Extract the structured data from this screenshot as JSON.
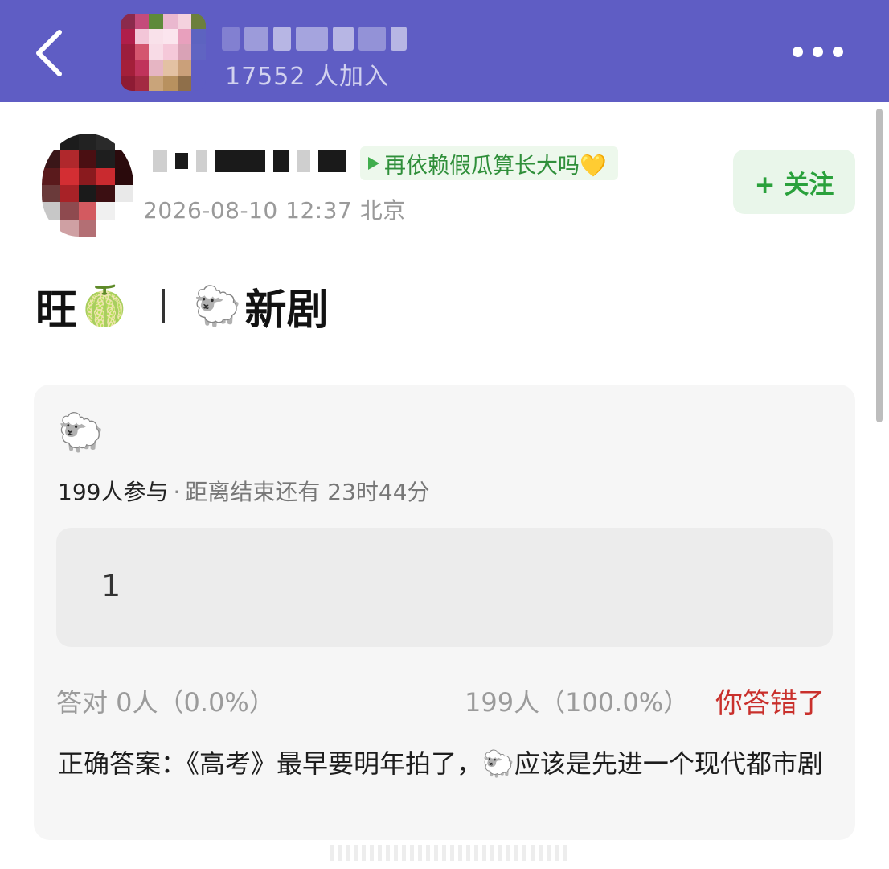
{
  "header": {
    "back_icon": "chevron-left-icon",
    "group_members": "17552 人加入",
    "more_icon": "more-horizontal-icon",
    "bar_color": "#5f5dc4"
  },
  "post": {
    "badge_text": "再依赖假瓜算长大吗💛",
    "time_location": "2026-08-10 12:37  北京",
    "follow_label": "+ 关注",
    "title_part1": "旺",
    "title_emoji1": "🍈",
    "title_emoji2": "🐑",
    "title_part2": "新剧"
  },
  "quiz": {
    "icon": "🐑",
    "participants": "199人参与",
    "separator": "·",
    "deadline": "距离结束还有 23时44分",
    "option_value": "1",
    "correct_stat": "答对  0人（0.0%）",
    "wrong_stat": "199人（100.0%）",
    "wrong_label": "你答错了",
    "answer_text": "正确答案：《高考》最早要明年拍了，🐑应该是先进一个现代都市剧"
  },
  "colors": {
    "accent_green": "#2aa13c",
    "wrong_red": "#c9302c"
  }
}
